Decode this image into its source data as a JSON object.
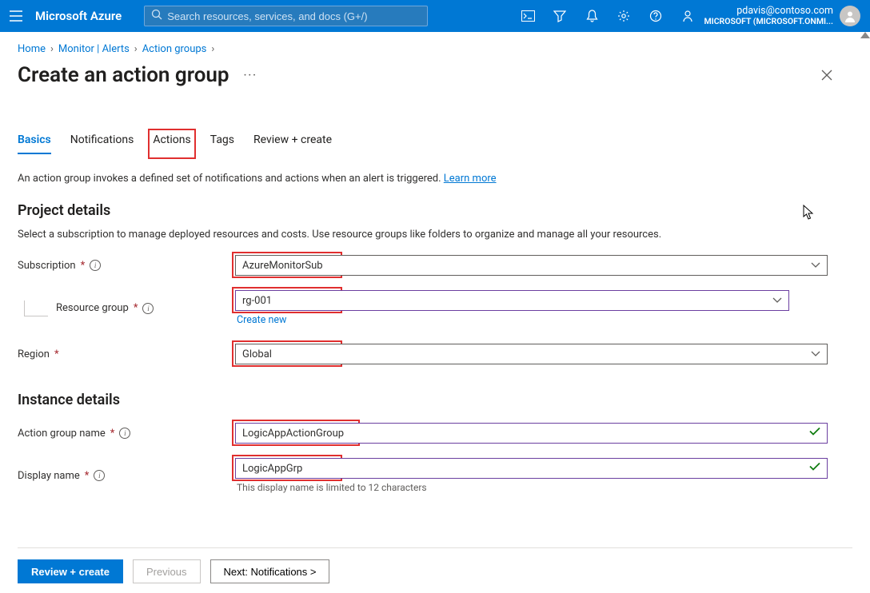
{
  "topbar": {
    "brand": "Microsoft Azure",
    "search_placeholder": "Search resources, services, and docs (G+/)",
    "account": {
      "email": "pdavis@contoso.com",
      "tenant": "MICROSOFT (MICROSOFT.ONMI..."
    }
  },
  "breadcrumb": {
    "items": [
      "Home",
      "Monitor | Alerts",
      "Action groups"
    ]
  },
  "title": "Create an action group",
  "tabs": [
    "Basics",
    "Notifications",
    "Actions",
    "Tags",
    "Review + create"
  ],
  "desc_prefix": "An action group invokes a defined set of notifications and actions when an alert is triggered. ",
  "desc_link": "Learn more",
  "project": {
    "heading": "Project details",
    "desc": "Select a subscription to manage deployed resources and costs. Use resource groups like folders to organize and manage all your resources.",
    "subscription_label": "Subscription",
    "subscription_value": "AzureMonitorSub",
    "rg_label": "Resource group",
    "rg_value": "rg-001",
    "create_new": "Create new",
    "region_label": "Region",
    "region_value": "Global"
  },
  "instance": {
    "heading": "Instance details",
    "agname_label": "Action group name",
    "agname_value": "LogicAppActionGroup",
    "display_label": "Display name",
    "display_value": "LogicAppGrp",
    "display_helper": "This display name is limited to 12 characters"
  },
  "footer": {
    "review": "Review + create",
    "previous": "Previous",
    "next": "Next: Notifications >"
  }
}
